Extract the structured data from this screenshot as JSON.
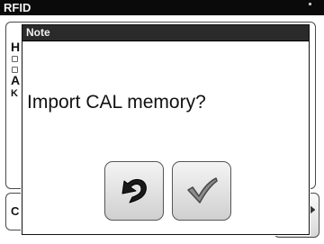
{
  "background_window": {
    "title": "RFID",
    "fragments": {
      "letter_1": "H",
      "letter_2": "A",
      "letter_3": "K",
      "letter_4": "C"
    }
  },
  "dialog": {
    "title": "Note",
    "message": "Import CAL memory?",
    "buttons": {
      "cancel_icon": "undo-arrow-icon",
      "confirm_icon": "checkmark-icon"
    }
  },
  "colors": {
    "titlebar": "#0a0a0a",
    "dialog_titlebar": "#2a2a2a",
    "button_face": "#e4e4e4",
    "icon_dark": "#1a1a1a",
    "icon_check": "#555555"
  }
}
